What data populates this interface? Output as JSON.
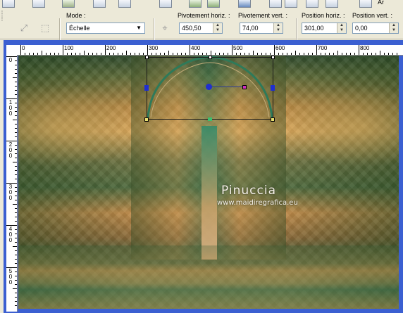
{
  "options": {
    "mode_label": "Mode :",
    "mode_value": "Échelle",
    "pivot_h_label": "Pivotement horiz. :",
    "pivot_h_value": "450,50",
    "pivot_v_label": "Pivotement vert. :",
    "pivot_v_value": "74,00",
    "pos_h_label": "Position horiz. :",
    "pos_h_value": "301,00",
    "pos_v_label": "Position vert. :",
    "pos_v_value": "0,00"
  },
  "ruler": {
    "h_labels": [
      "0",
      "100",
      "200",
      "300",
      "400",
      "500",
      "600",
      "700",
      "800"
    ],
    "v_labels": [
      {
        "text": "0"
      },
      {
        "text": "1 0 0"
      },
      {
        "text": "2 0 0"
      },
      {
        "text": "3 0 0"
      },
      {
        "text": "4 0 0"
      },
      {
        "text": "5 0 0"
      }
    ]
  },
  "canvas": {
    "watermark_name": "Pinuccia",
    "watermark_url": "www.maidiregrafica.eu"
  },
  "colors": {
    "frame": "#3b5fd1",
    "panel": "#ece9d8",
    "handle_blue": "#1f2fd0",
    "handle_yellow": "#e8e070",
    "handle_green": "#3ac070",
    "handle_magenta": "#d030c0"
  }
}
